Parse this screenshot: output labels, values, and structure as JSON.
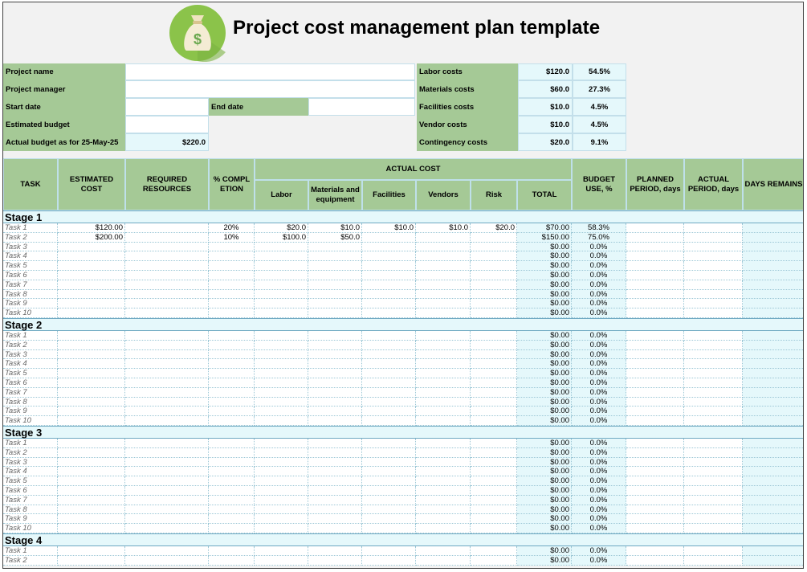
{
  "title": "Project cost management plan template",
  "logo": {
    "icon": "money-bag-icon",
    "symbol": "$",
    "colors": {
      "circle": "#8bc34a",
      "bag": "#f4ecd4",
      "dollar": "#6aa84f"
    }
  },
  "info": {
    "project_name_label": "Project name",
    "project_manager_label": "Project manager",
    "start_date_label": "Start date",
    "end_date_label": "End date",
    "estimated_budget_label": "Estimated budget",
    "actual_budget_label": "Actual budget as for 25-May-25",
    "actual_budget_value": "$220.0",
    "project_name": "",
    "project_manager": "",
    "start_date": "",
    "end_date": "",
    "estimated_budget": ""
  },
  "costs": [
    {
      "label": "Labor costs",
      "value": "$120.0",
      "pct": "54.5%"
    },
    {
      "label": "Materials costs",
      "value": "$60.0",
      "pct": "27.3%"
    },
    {
      "label": "Facilities costs",
      "value": "$10.0",
      "pct": "4.5%"
    },
    {
      "label": "Vendor costs",
      "value": "$10.0",
      "pct": "4.5%"
    },
    {
      "label": "Contingency costs",
      "value": "$20.0",
      "pct": "9.1%"
    }
  ],
  "headers": {
    "task": "TASK",
    "estimated_cost": "ESTIMATED COST",
    "required_resources": "REQUIRED RESOURCES",
    "completion": "% COMPLETION",
    "actual_cost": "ACTUAL COST",
    "labor": "Labor",
    "materials": "Materials and equipment",
    "facilities": "Facilities",
    "vendors": "Vendors",
    "risk": "Risk",
    "total": "TOTAL",
    "budget_use": "BUDGET USE, %",
    "planned_period": "PLANNED PERIOD, days",
    "actual_period": "ACTUAL PERIOD, days",
    "days_remains": "DAYS REMAINS"
  },
  "stages": [
    {
      "name": "Stage 1",
      "tasks": [
        {
          "task": "Task 1",
          "est": "$120.00",
          "res": "",
          "comp": "20%",
          "labor": "$20.0",
          "mat": "$10.0",
          "fac": "$10.0",
          "ven": "$10.0",
          "risk": "$20.0",
          "total": "$70.00",
          "use": "58.3%"
        },
        {
          "task": "Task 2",
          "est": "$200.00",
          "res": "",
          "comp": "10%",
          "labor": "$100.0",
          "mat": "$50.0",
          "fac": "",
          "ven": "",
          "risk": "",
          "total": "$150.00",
          "use": "75.0%"
        },
        {
          "task": "Task 3",
          "total": "$0.00",
          "use": "0.0%"
        },
        {
          "task": "Task 4",
          "total": "$0.00",
          "use": "0.0%"
        },
        {
          "task": "Task 5",
          "total": "$0.00",
          "use": "0.0%"
        },
        {
          "task": "Task 6",
          "total": "$0.00",
          "use": "0.0%"
        },
        {
          "task": "Task 7",
          "total": "$0.00",
          "use": "0.0%"
        },
        {
          "task": "Task 8",
          "total": "$0.00",
          "use": "0.0%"
        },
        {
          "task": "Task 9",
          "total": "$0.00",
          "use": "0.0%"
        },
        {
          "task": "Task 10",
          "total": "$0.00",
          "use": "0.0%"
        }
      ]
    },
    {
      "name": "Stage 2",
      "tasks": [
        {
          "task": "Task 1",
          "total": "$0.00",
          "use": "0.0%"
        },
        {
          "task": "Task 2",
          "total": "$0.00",
          "use": "0.0%"
        },
        {
          "task": "Task 3",
          "total": "$0.00",
          "use": "0.0%"
        },
        {
          "task": "Task 4",
          "total": "$0.00",
          "use": "0.0%"
        },
        {
          "task": "Task 5",
          "total": "$0.00",
          "use": "0.0%"
        },
        {
          "task": "Task 6",
          "total": "$0.00",
          "use": "0.0%"
        },
        {
          "task": "Task 7",
          "total": "$0.00",
          "use": "0.0%"
        },
        {
          "task": "Task 8",
          "total": "$0.00",
          "use": "0.0%"
        },
        {
          "task": "Task 9",
          "total": "$0.00",
          "use": "0.0%"
        },
        {
          "task": "Task 10",
          "total": "$0.00",
          "use": "0.0%"
        }
      ]
    },
    {
      "name": "Stage 3",
      "tasks": [
        {
          "task": "Task 1",
          "total": "$0.00",
          "use": "0.0%"
        },
        {
          "task": "Task 2",
          "total": "$0.00",
          "use": "0.0%"
        },
        {
          "task": "Task 3",
          "total": "$0.00",
          "use": "0.0%"
        },
        {
          "task": "Task 4",
          "total": "$0.00",
          "use": "0.0%"
        },
        {
          "task": "Task 5",
          "total": "$0.00",
          "use": "0.0%"
        },
        {
          "task": "Task 6",
          "total": "$0.00",
          "use": "0.0%"
        },
        {
          "task": "Task 7",
          "total": "$0.00",
          "use": "0.0%"
        },
        {
          "task": "Task 8",
          "total": "$0.00",
          "use": "0.0%"
        },
        {
          "task": "Task 9",
          "total": "$0.00",
          "use": "0.0%"
        },
        {
          "task": "Task 10",
          "total": "$0.00",
          "use": "0.0%"
        }
      ]
    },
    {
      "name": "Stage 4",
      "tasks": [
        {
          "task": "Task 1",
          "total": "$0.00",
          "use": "0.0%"
        },
        {
          "task": "Task 2",
          "total": "$0.00",
          "use": "0.0%"
        }
      ]
    }
  ]
}
